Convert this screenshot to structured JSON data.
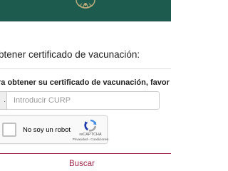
{
  "colors": {
    "header_green": "#1e5b4f",
    "accent_maroon": "#9d2449",
    "text": "#222222",
    "placeholder": "#9a9a9a"
  },
  "header": {
    "emblem_icon": "mexico-coat-of-arms-icon"
  },
  "form": {
    "section_title": "btener certificado de vacunación:",
    "instruction": "ra obtener su certificado de vacunación, favor de in",
    "curp": {
      "addon_text": ".",
      "placeholder": "Introducir CURP",
      "value": ""
    },
    "recaptcha": {
      "checkbox_label": "No soy un robot",
      "brand": "reCAPTCHA",
      "privacy_link": "Privacidad",
      "separator": " - ",
      "terms_link": "Condiciones",
      "logo_icon": "recaptcha-logo-icon",
      "checked": false
    },
    "search_button": "Buscar"
  }
}
